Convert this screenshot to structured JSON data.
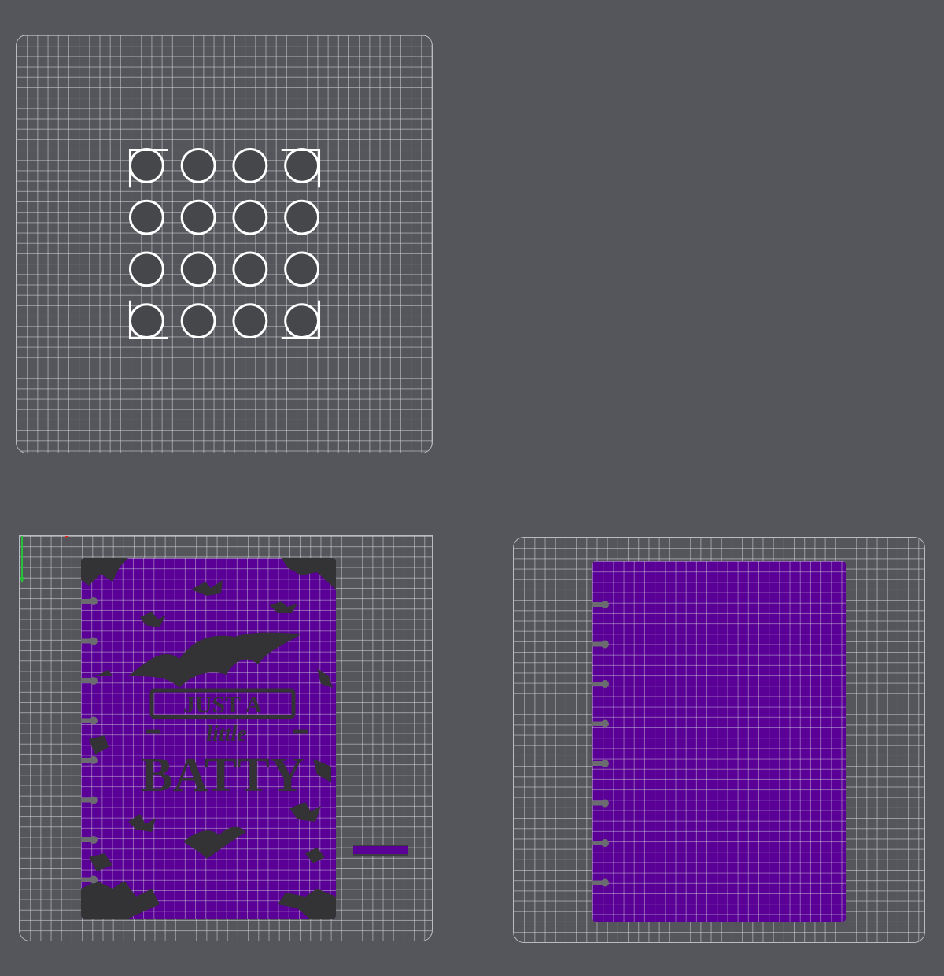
{
  "viewport": {
    "background": "#55565b"
  },
  "plates": [
    {
      "id": "plate-1",
      "content": "disc-array",
      "grid_color": "#c8cacf"
    },
    {
      "id": "plate-2",
      "content": "printed-cover",
      "grid_color": "#c8cacf"
    },
    {
      "id": "plate-3",
      "content": "plain-cover",
      "grid_color": "#c8cacf"
    }
  ],
  "disc_array": {
    "rows": 4,
    "columns": 4,
    "outline_color": "#ffffff",
    "fill_color": "#46474b"
  },
  "cover": {
    "color": "#5a0097",
    "disc_notch_count": 8,
    "notch_color": "#6b6c70"
  },
  "artwork": {
    "lines": [
      "JUST A",
      "little",
      "BATTY"
    ],
    "ink_color": "#333336"
  },
  "axis_gizmo": {
    "x_color": "#e0261c",
    "y_color": "#27c23a",
    "z_color": "#2a3cf0"
  }
}
